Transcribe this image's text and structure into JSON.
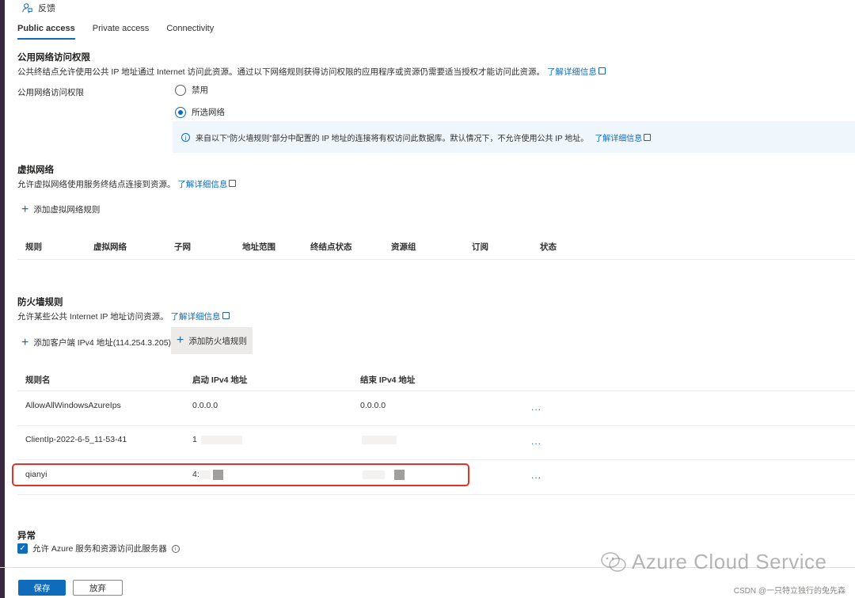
{
  "feedback": {
    "label": "反馈"
  },
  "tabs": [
    {
      "label": "Public access",
      "active": true
    },
    {
      "label": "Private access",
      "active": false
    },
    {
      "label": "Connectivity",
      "active": false
    }
  ],
  "public_access": {
    "title": "公用网络访问权限",
    "description": "公共终结点允许使用公共 IP 地址通过 Internet 访问此资源。通过以下网络规则获得访问权限的应用程序或资源仍需要适当授权才能访问此资源。",
    "learn_more": "了解详细信息",
    "field_label": "公用网络访问权限",
    "options": [
      {
        "label": "禁用",
        "checked": false
      },
      {
        "label": "所选网络",
        "checked": true
      }
    ],
    "info_text": "来自以下“防火墙规则”部分中配置的 IP 地址的连接将有权访问此数据库。默认情况下，不允许使用公共 IP 地址。",
    "info_link": "了解详细信息"
  },
  "vnet": {
    "title": "虚拟网络",
    "description": "允许虚拟网络使用服务终结点连接到资源。",
    "learn_more": "了解详细信息",
    "add_label": "添加虚拟网络规则",
    "columns": [
      "规则",
      "虚拟网络",
      "子网",
      "地址范围",
      "终结点状态",
      "资源组",
      "订阅",
      "状态"
    ]
  },
  "firewall": {
    "title": "防火墙规则",
    "description": "允许某些公共 Internet IP 地址访问资源。",
    "learn_more": "了解详细信息",
    "add_client_label": "添加客户端 IPv4 地址(114.254.3.205)",
    "add_rule_label": "添加防火墙规则",
    "columns": [
      "规则名",
      "启动 IPv4 地址",
      "结束 IPv4 地址"
    ],
    "rows": [
      {
        "name": "AllowAllWindowsAzureIps",
        "start": "0.0.0.0",
        "end": "0.0.0.0",
        "more": "..."
      },
      {
        "name": "ClientIp-2022-6-5_11-53-41",
        "start": "1",
        "end": "",
        "more": "..."
      },
      {
        "name": "qianyi",
        "start": "4:",
        "end": "",
        "more": "..."
      }
    ]
  },
  "exceptions": {
    "title": "异常",
    "checkbox_label": "允许 Azure 服务和资源访问此服务器",
    "checked": true
  },
  "footer": {
    "save": "保存",
    "discard": "放弃"
  },
  "watermark": {
    "text": "Azure Cloud Service"
  },
  "credit": {
    "text": "CSDN @一只特立独行的兔先森"
  },
  "colors": {
    "accent": "#0f6cbd",
    "highlight": "#e0342a",
    "info_bg": "#eff6fc"
  }
}
